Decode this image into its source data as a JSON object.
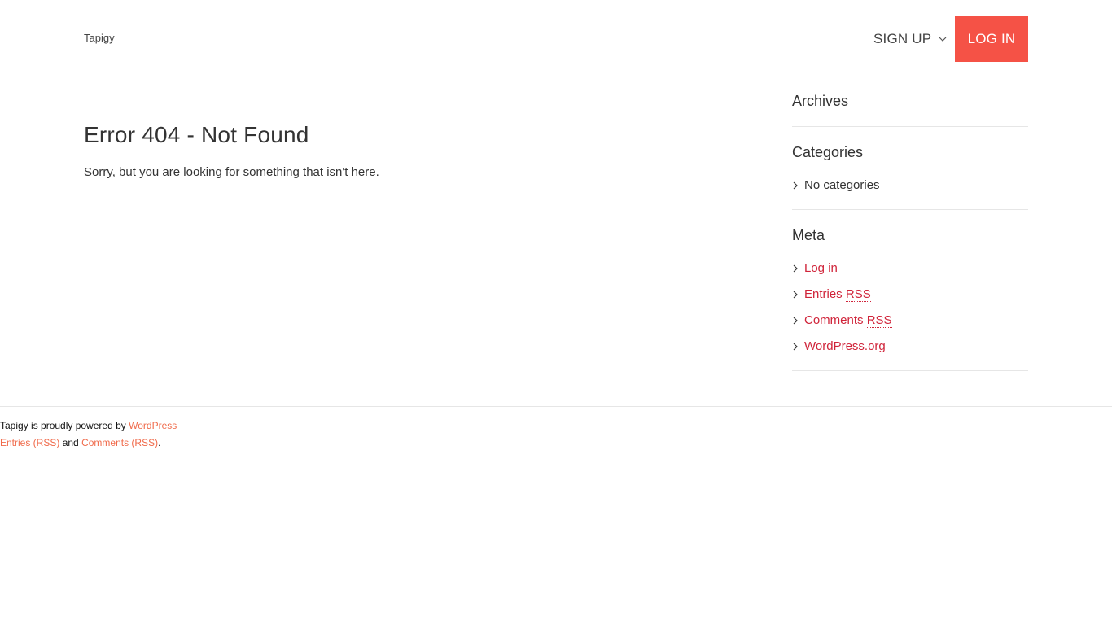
{
  "header": {
    "logo_alt": "Tapigy",
    "signup_label": "SIGN UP",
    "login_label": "LOG IN",
    "accent_color": "#f55246"
  },
  "main": {
    "title": "Error 404 - Not Found",
    "message": "Sorry, but you are looking for something that isn't here."
  },
  "sidebar": {
    "archives_title": "Archives",
    "categories_title": "Categories",
    "categories_items": [
      "No categories"
    ],
    "meta_title": "Meta",
    "meta_items": [
      {
        "label": "Log in"
      },
      {
        "label": "Entries",
        "abbr": "RSS"
      },
      {
        "label": "Comments",
        "abbr": "RSS"
      },
      {
        "label": "WordPress.org"
      }
    ],
    "link_color": "#d0243a"
  },
  "footer": {
    "powered_text": "Tapigy is proudly powered by",
    "wordpress_link": "WordPress",
    "entries_link": "Entries (RSS)",
    "and_text": "and",
    "comments_link": "Comments (RSS)",
    "end_period": ".",
    "link_color": "#f06a4a"
  }
}
